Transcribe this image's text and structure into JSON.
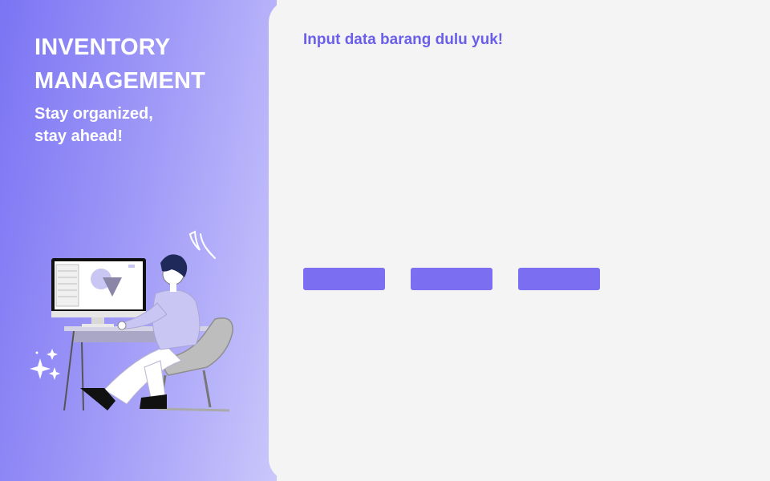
{
  "sidebar": {
    "title": "INVENTORY MANAGEMENT",
    "tagline_line1": "Stay organized,",
    "tagline_line2": "stay ahead!",
    "illustration": "person-at-computer-illustration"
  },
  "main": {
    "prompt": "Input data barang dulu yuk!",
    "buttons": [
      {
        "label": ""
      },
      {
        "label": ""
      },
      {
        "label": ""
      }
    ]
  },
  "colors": {
    "accent": "#7b6ef0",
    "prompt_text": "#6a5fe8",
    "background": "#f4f4f4",
    "sidebar_gradient_start": "#7b74f4",
    "sidebar_gradient_end": "#cac7fb"
  }
}
